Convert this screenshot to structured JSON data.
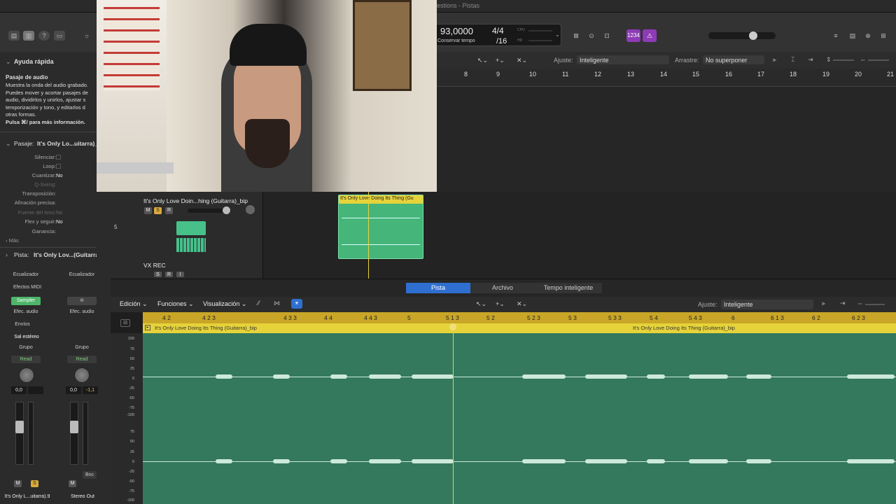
{
  "topbar": {
    "title": "estions - Pistas"
  },
  "lcd": {
    "tempo": "93,0000",
    "tempo_label": "Conservar tempo",
    "sig_top": "4/4",
    "sig_bottom": "/16",
    "cpu": "CPU",
    "hd": "HD"
  },
  "toolbar": {
    "count_in": "1234"
  },
  "arrange": {
    "snap_label": "Ajuste:",
    "snap_value": "Inteligente",
    "drag_label": "Arrastre:",
    "drag_value": "No superponer",
    "bars": [
      "8",
      "9",
      "10",
      "11",
      "12",
      "13",
      "14",
      "15",
      "16",
      "17",
      "18",
      "19",
      "20",
      "21"
    ]
  },
  "quickhelp": {
    "header": "Ayuda rápida",
    "title": "Pasaje de audio",
    "lines": [
      "Muestra la onda del audio grabado.",
      "Puedes mover y acortar pasajes de",
      "audio, dividirlos y unirlos, ajustar s",
      "temporización y tono, y editarlos d",
      "otras formas."
    ],
    "more": "Pulsa ⌘/ para más información."
  },
  "region_inspector": {
    "header": "Pasaje:",
    "name": "It's Only Lo...uitarra)_(",
    "rows": [
      {
        "k": "Silenciar:",
        "v": ""
      },
      {
        "k": "Loop:",
        "v": ""
      },
      {
        "k": "Cuantizar:",
        "v": "No"
      },
      {
        "k": "Q-Swing:",
        "v": ""
      },
      {
        "k": "Transposición:",
        "v": ""
      },
      {
        "k": "Afinación precisa:",
        "v": ""
      },
      {
        "k": "Fuente del tono:",
        "v": "No"
      },
      {
        "k": "Flex y seguir:",
        "v": "No"
      },
      {
        "k": "Ganancia:",
        "v": ""
      }
    ],
    "more": "Más"
  },
  "track_inspector": {
    "header": "Pista:",
    "name": "It's Only Lov...(Guitarra).9"
  },
  "tracks": [
    {
      "number": "5",
      "name": "It's Only Love Doin...hing (Guitarra)_bip",
      "m": "M",
      "s": "S",
      "r": "R"
    },
    {
      "name": "VX REC",
      "s": "S",
      "r": "R",
      "i": "I"
    }
  ],
  "region": {
    "label": "It's Only Love Doing Its Thing (Gu"
  },
  "mixer": {
    "strip1": {
      "eq": "Ecualizador",
      "midi": "Efectos MIDI",
      "inst": "Sampler",
      "fx": "Efec. audio",
      "sends": "Envíos",
      "out": "Sal estéreo",
      "group": "Grupo",
      "read": "Read",
      "vol": "0,0",
      "name": "It's Only L...uitarra).9",
      "m": "M",
      "s": "S"
    },
    "strip2": {
      "eq": "Ecualizador",
      "fx": "Efec. audio",
      "group": "Grupo",
      "read": "Read",
      "vol": "0,0",
      "peak": "-1,1",
      "bnc": "Bnc",
      "name": "Stereo Out",
      "m": "M"
    }
  },
  "tabs": [
    "Pista",
    "Archivo",
    "Tempo inteligente"
  ],
  "editor": {
    "menus": [
      "Edición",
      "Funciones",
      "Visualización"
    ],
    "snap_label": "Ajuste:",
    "snap_value": "Inteligente",
    "ruler": [
      "4 2",
      "4 2 3",
      "4 3 3",
      "4 4",
      "4 4 3",
      "5",
      "5 1 3",
      "5 2",
      "5 2 3",
      "5 3",
      "5 3 3",
      "5 4",
      "5 4 3",
      "6",
      "6 1 3",
      "6 2",
      "6 2 3"
    ],
    "region_name": "It's Only Love Doing Its Thing (Guitarra)_bip",
    "region_name2": "It's Only Love Doing Its Thing (Guitarra)_bip",
    "amp": [
      "100",
      "75",
      "50",
      "25",
      "0",
      "-25",
      "-50",
      "-75",
      "-100",
      "75",
      "50",
      "25",
      "0",
      "-25",
      "-50",
      "-75",
      "-100"
    ]
  },
  "colors": {
    "accent": "#2f6fd0",
    "region_yellow": "#e6d33a",
    "wave_green": "#34795d",
    "solo": "#d9a93a",
    "sampler": "#4fb56a"
  }
}
